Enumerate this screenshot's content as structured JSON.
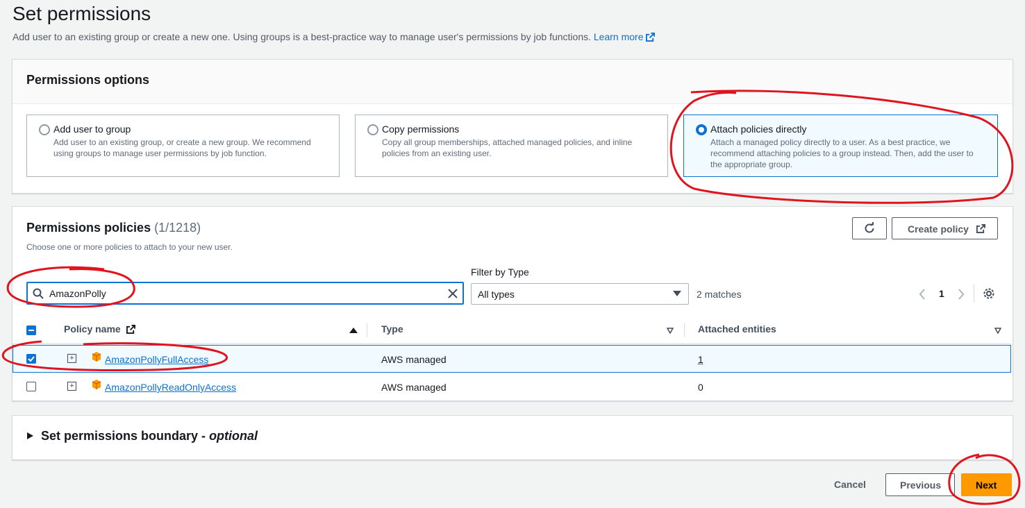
{
  "header": {
    "title": "Set permissions",
    "description": "Add user to an existing group or create a new one. Using groups is a best-practice way to manage user's permissions by job functions.",
    "learn_more": "Learn more"
  },
  "permissions_options": {
    "title": "Permissions options",
    "options": [
      {
        "label": "Add user to group",
        "description": "Add user to an existing group, or create a new group. We recommend using groups to manage user permissions by job function.",
        "selected": false
      },
      {
        "label": "Copy permissions",
        "description": "Copy all group memberships, attached managed policies, and inline policies from an existing user.",
        "selected": false
      },
      {
        "label": "Attach policies directly",
        "description": "Attach a managed policy directly to a user. As a best practice, we recommend attaching policies to a group instead. Then, add the user to the appropriate group.",
        "selected": true
      }
    ]
  },
  "policies": {
    "title": "Permissions policies",
    "count": "(1/1218)",
    "subtitle": "Choose one or more policies to attach to your new user.",
    "create_policy": "Create policy",
    "search_value": "AmazonPolly",
    "filter_label": "Filter by Type",
    "filter_value": "All types",
    "matches": "2 matches",
    "page": "1",
    "columns": {
      "name": "Policy name",
      "type": "Type",
      "attached": "Attached entities"
    },
    "rows": [
      {
        "name": "AmazonPollyFullAccess",
        "type": "AWS managed",
        "attached": "1",
        "checked": true
      },
      {
        "name": "AmazonPollyReadOnlyAccess",
        "type": "AWS managed",
        "attached": "0",
        "checked": false
      }
    ]
  },
  "boundary": {
    "title": "Set permissions boundary - ",
    "optional": "optional"
  },
  "footer": {
    "cancel": "Cancel",
    "previous": "Previous",
    "next": "Next"
  },
  "colors": {
    "primary": "#ff9900",
    "link": "#0972d3",
    "annotation": "#e0141e"
  }
}
